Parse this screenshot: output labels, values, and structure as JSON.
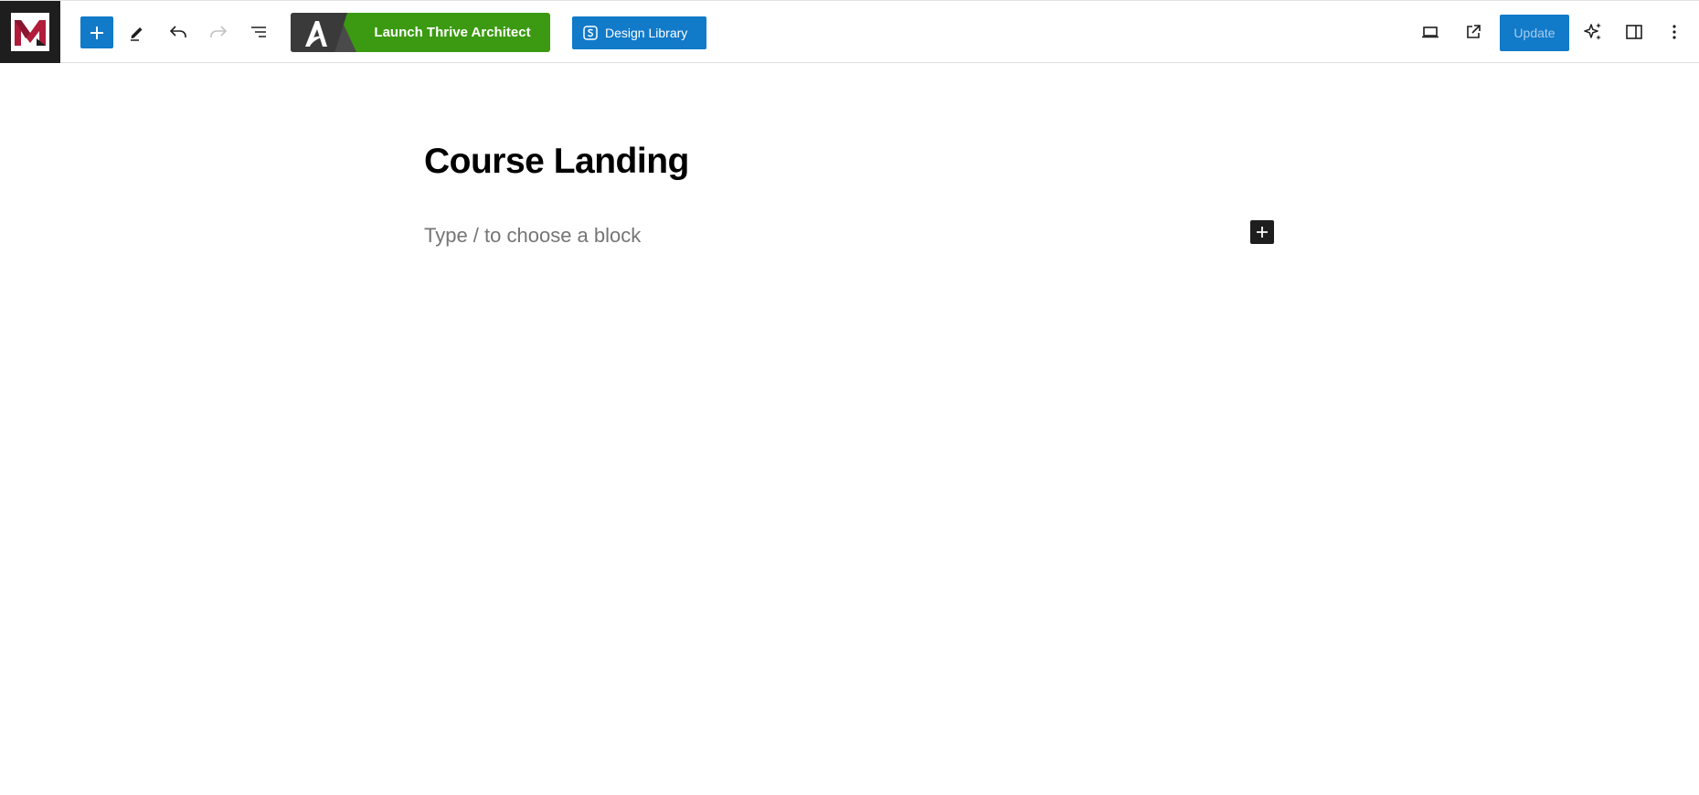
{
  "toolbar": {
    "logo_icon": "site-logo-icon",
    "inserter_icon": "plus-icon",
    "tools_icon": "pencil-icon",
    "undo_icon": "undo-icon",
    "redo_icon": "redo-icon",
    "list_view_icon": "list-view-icon",
    "thrive_label": "Launch Thrive Architect",
    "design_library_label": "Design Library",
    "preview_icon": "laptop-icon",
    "view_post_icon": "external-link-icon",
    "update_label": "Update",
    "ai_icon": "sparkles-icon",
    "settings_icon": "sidebar-icon",
    "options_icon": "more-vertical-icon"
  },
  "editor": {
    "post_title": "Course Landing",
    "block_placeholder": "Type / to choose a block"
  },
  "colors": {
    "accent": "#117ac9",
    "thrive_green": "#3b9a11",
    "dark": "#1e1e1e",
    "logo_red": "#b01c3a"
  }
}
